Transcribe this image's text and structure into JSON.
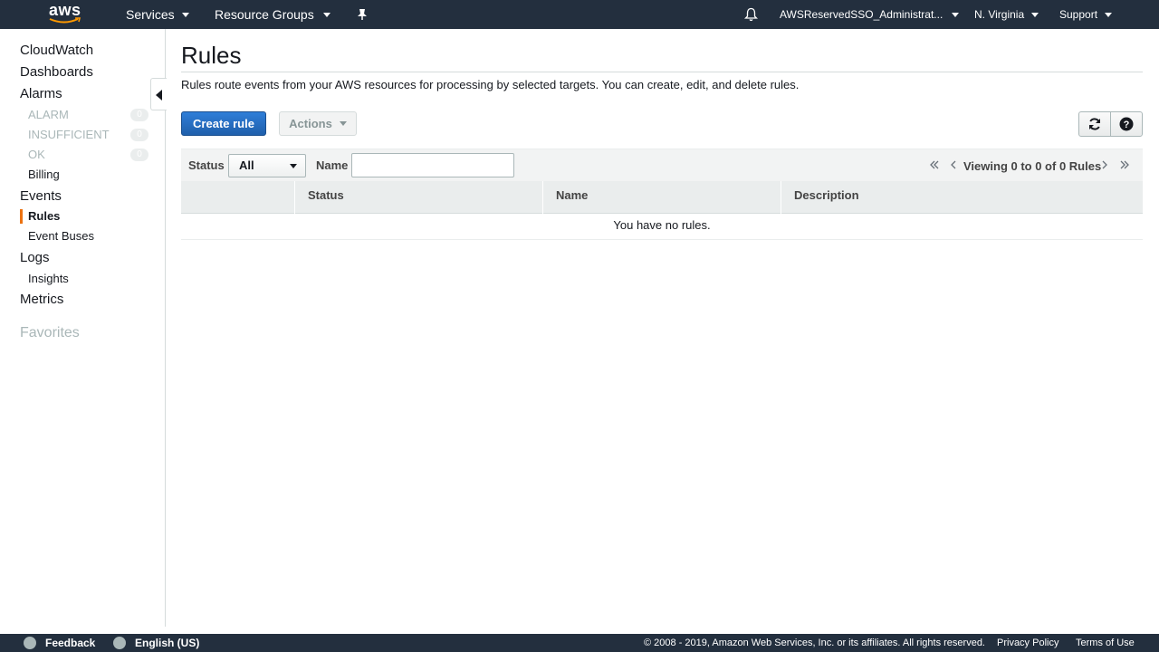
{
  "topnav": {
    "logo_text": "aws",
    "services_label": "Services",
    "resource_groups_label": "Resource Groups",
    "account_label": "AWSReservedSSO_Administrat...",
    "region_label": "N. Virginia",
    "support_label": "Support"
  },
  "sidebar": {
    "cloudwatch": "CloudWatch",
    "dashboards": "Dashboards",
    "alarms": "Alarms",
    "alarm_states": [
      {
        "label": "ALARM",
        "count": "0"
      },
      {
        "label": "INSUFFICIENT",
        "count": "0"
      },
      {
        "label": "OK",
        "count": "0"
      }
    ],
    "billing": "Billing",
    "events": "Events",
    "rules": "Rules",
    "event_buses": "Event Buses",
    "logs": "Logs",
    "insights": "Insights",
    "metrics": "Metrics",
    "favorites": "Favorites"
  },
  "main": {
    "title": "Rules",
    "description": "Rules route events from your AWS resources for processing by selected targets. You can create, edit, and delete rules.",
    "create_button": "Create rule",
    "actions_button": "Actions",
    "filter": {
      "status_label": "Status",
      "status_value": "All",
      "name_label": "Name",
      "name_value": ""
    },
    "pagination": "Viewing 0 to 0 of 0 Rules",
    "table": {
      "columns": [
        "Status",
        "Name",
        "Description"
      ],
      "empty_message": "You have no rules."
    }
  },
  "footer": {
    "feedback": "Feedback",
    "language": "English (US)",
    "copyright": "© 2008 - 2019, Amazon Web Services, Inc. or its affiliates. All rights reserved.",
    "privacy": "Privacy Policy",
    "terms": "Terms of Use"
  },
  "colors": {
    "nav_bg": "#232f3e",
    "primary_button": "#1f5fab",
    "active_marker": "#ec7211"
  },
  "icons": {
    "notifications": "bell-icon",
    "pin": "pin-icon",
    "refresh": "refresh-icon",
    "help": "help-icon",
    "feedback": "speech-bubble-icon",
    "language": "globe-icon"
  }
}
